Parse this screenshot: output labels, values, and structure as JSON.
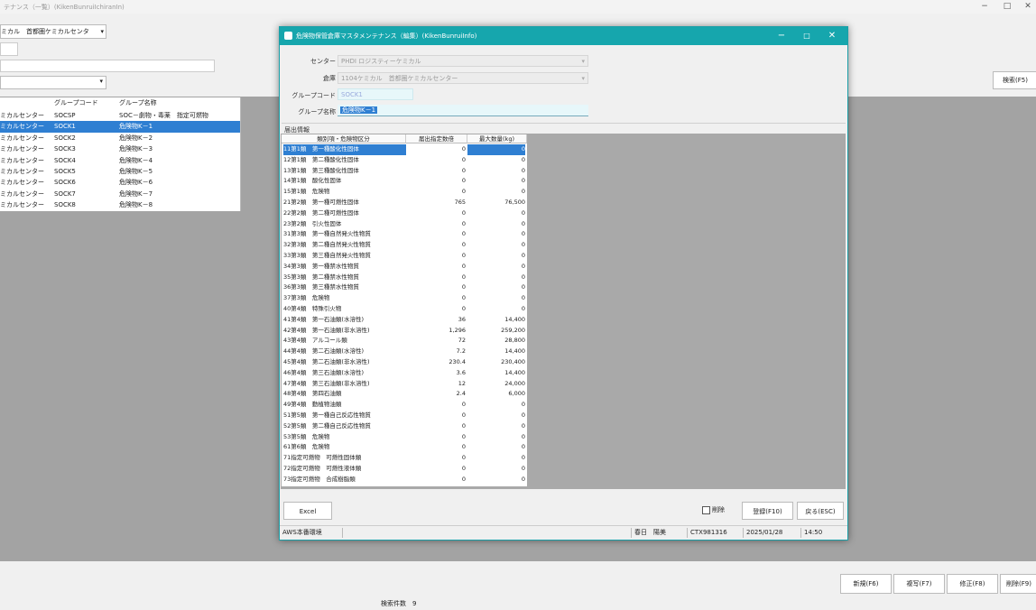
{
  "bg": {
    "title": "テナンス（一覧）(KikenBunruiIchiranIn)",
    "controls": {
      "min": "−",
      "max": "□",
      "close": "✕"
    },
    "center_combo": "ミカル　首都圏ケミカルセンタ",
    "search_button": "検索(F5)",
    "grid": {
      "headers": [
        "グループコード",
        "グループ名称"
      ],
      "rows": [
        [
          "ミカルセンター",
          "SOCSP",
          "SOC－劇物・毒薬　指定可燃物"
        ],
        [
          "ミカルセンター",
          "SOCK1",
          "危険物K－1"
        ],
        [
          "ミカルセンター",
          "SOCK2",
          "危険物K－2"
        ],
        [
          "ミカルセンター",
          "SOCK3",
          "危険物K－3"
        ],
        [
          "ミカルセンター",
          "SOCK4",
          "危険物K－4"
        ],
        [
          "ミカルセンター",
          "SOCK5",
          "危険物K－5"
        ],
        [
          "ミカルセンター",
          "SOCK6",
          "危険物K－6"
        ],
        [
          "ミカルセンター",
          "SOCK7",
          "危険物K－7"
        ],
        [
          "ミカルセンター",
          "SOCK8",
          "危険物K－8"
        ]
      ]
    },
    "bottom_buttons": [
      "新規(F6)",
      "複写(F7)",
      "修正(F8)",
      "削除(F9)"
    ],
    "count_label": "検索件数　9"
  },
  "dialog": {
    "title": "危険物保管倉庫マスタメンテナンス（編集）(KikenBunruiInfo)",
    "controls": {
      "min": "−",
      "max": "□",
      "close": "✕"
    },
    "center_label": "センター",
    "center_value": "PHDI ロジスティーケミカル",
    "warehouse_label": "倉庫",
    "warehouse_value": "1104ケミカル　首都圏ケミカルセンター",
    "dropdown_icon": "▾",
    "group_code_label": "グループコード",
    "group_code_value": "SOCK1",
    "group_name_label": "グループ名称",
    "group_name_value": "危険物K－1",
    "reg_caption": "届出情報",
    "grid_headers": [
      "類別項・危険物区分",
      "届出指定数倍",
      "最大数量(kg)"
    ],
    "rows": [
      [
        "11第1類　第一種酸化性固体",
        "0",
        "0"
      ],
      [
        "12第1類　第二種酸化性固体",
        "0",
        "0"
      ],
      [
        "13第1類　第三種酸化性固体",
        "0",
        "0"
      ],
      [
        "14第1類　酸化性固体",
        "0",
        "0"
      ],
      [
        "15第1類　危険物",
        "0",
        "0"
      ],
      [
        "21第2類　第一種可燃性固体",
        "765",
        "76,500"
      ],
      [
        "22第2類　第二種可燃性固体",
        "0",
        "0"
      ],
      [
        "23第2類　引火性固体",
        "0",
        "0"
      ],
      [
        "31第3類　第一種自然発火性物質",
        "0",
        "0"
      ],
      [
        "32第3類　第二種自然発火性物質",
        "0",
        "0"
      ],
      [
        "33第3類　第三種自然発火性物質",
        "0",
        "0"
      ],
      [
        "34第3類　第一種禁水性物質",
        "0",
        "0"
      ],
      [
        "35第3類　第二種禁水性物質",
        "0",
        "0"
      ],
      [
        "36第3類　第三種禁水性物質",
        "0",
        "0"
      ],
      [
        "37第3類　危険物",
        "0",
        "0"
      ],
      [
        "40第4類　特殊引火物",
        "0",
        "0"
      ],
      [
        "41第4類　第一石油類(水溶性)",
        "36",
        "14,400"
      ],
      [
        "42第4類　第一石油類(非水溶性)",
        "1,296",
        "259,200"
      ],
      [
        "43第4類　アルコール類",
        "72",
        "28,800"
      ],
      [
        "44第4類　第二石油類(水溶性)",
        "7.2",
        "14,400"
      ],
      [
        "45第4類　第二石油類(非水溶性)",
        "230.4",
        "230,400"
      ],
      [
        "46第4類　第三石油類(水溶性)",
        "3.6",
        "14,400"
      ],
      [
        "47第4類　第三石油類(非水溶性)",
        "12",
        "24,000"
      ],
      [
        "48第4類　第四石油類",
        "2.4",
        "6,000"
      ],
      [
        "49第4類　動植物油類",
        "0",
        "0"
      ],
      [
        "51第5類　第一種自己反応性物質",
        "0",
        "0"
      ],
      [
        "52第5類　第二種自己反応性物質",
        "0",
        "0"
      ],
      [
        "53第5類　危険物",
        "0",
        "0"
      ],
      [
        "61第6類　危険物",
        "0",
        "0"
      ],
      [
        "71指定可燃物　可燃性固体類",
        "0",
        "0"
      ],
      [
        "72指定可燃物　可燃性液体類",
        "0",
        "0"
      ],
      [
        "73指定可燃物　合成樹脂類",
        "0",
        "0"
      ]
    ],
    "excel_button": "Excel",
    "delete_checkbox": "削除",
    "register_button": "登録(F10)",
    "back_button": "戻る(ESC)",
    "status": {
      "env": "AWS本番環境",
      "user": "春日　陽美",
      "terminal": "CTX981316",
      "date": "2025/01/28",
      "time": "14:50"
    }
  }
}
